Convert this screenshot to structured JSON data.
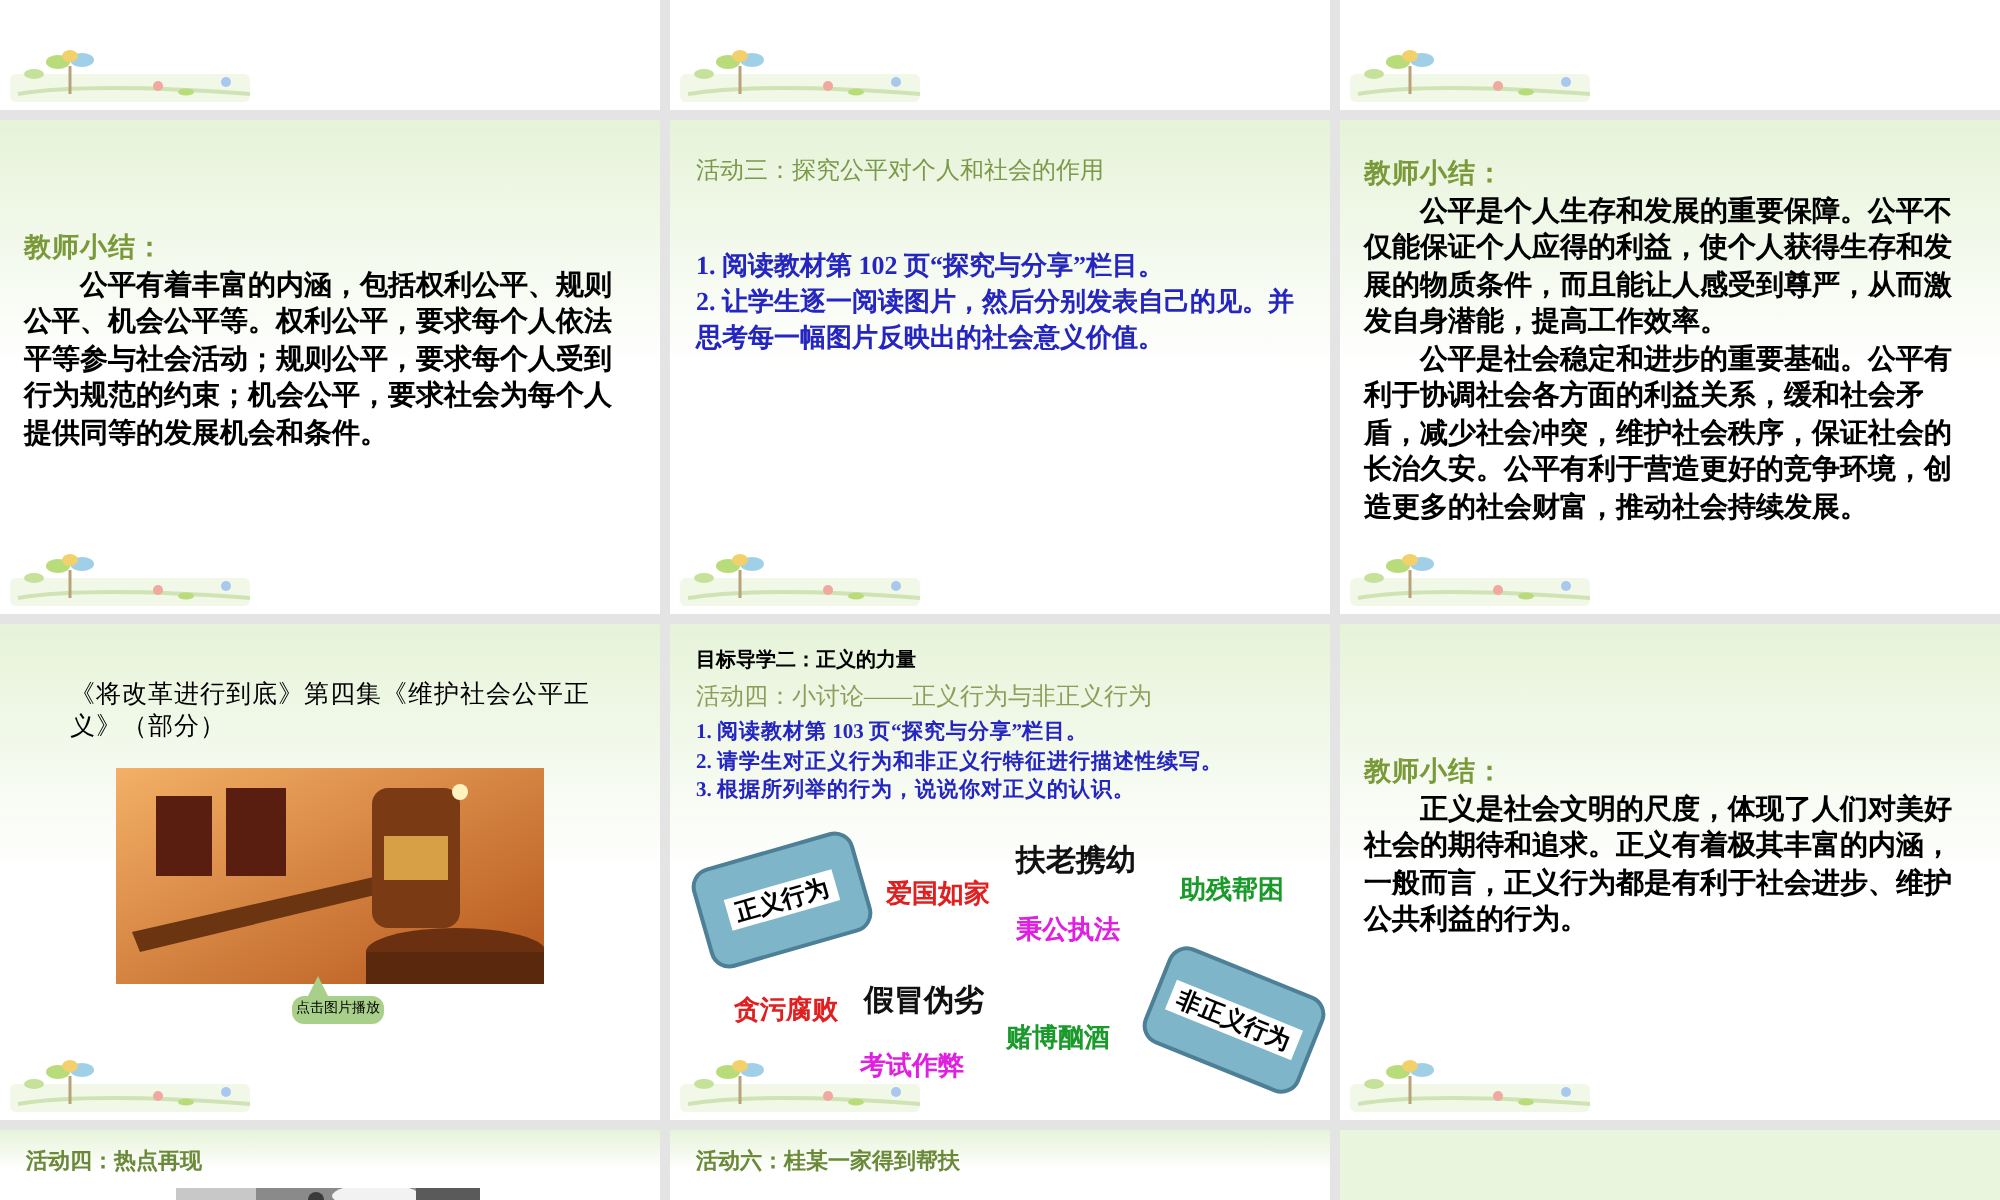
{
  "slides": [
    {
      "kind": "blank"
    },
    {
      "kind": "blank"
    },
    {
      "kind": "blank"
    },
    {
      "kind": "summary",
      "heading": "教师小结：",
      "paragraphs": [
        "公平有着丰富的内涵，包括权利公平、规则公平、机会公平等。权利公平，要求每个人依法平等参与社会活动；规则公平，要求每个人受到行为规范的约束；机会公平，要求社会为每个人提供同等的发展机会和条件。"
      ]
    },
    {
      "kind": "activity",
      "title": "活动三：探究公平对个人和社会的作用",
      "items": [
        "1. 阅读教材第 102 页“探究与分享”栏目。",
        "2. 让学生逐一阅读图片，然后分别发表自己的见。并思考每一幅图片反映出的社会意义价值。"
      ]
    },
    {
      "kind": "summary",
      "heading": "教师小结：",
      "paragraphs": [
        "公平是个人生存和发展的重要保障。公平不仅能保证个人应得的利益，使个人获得生存和发展的物质条件，而且能让人感受到尊严，从而激发自身潜能，提高工作效率。",
        "公平是社会稳定和进步的重要基础。公平有利于协调社会各方面的利益关系，缓和社会矛盾，减少社会冲突，维护社会秩序，保证社会的长治久安。公平有利于营造更好的竞争环境，创造更多的社会财富，推动社会持续发展。"
      ]
    },
    {
      "kind": "video",
      "caption": "《将改革进行到底》第四集《维护社会公平正义》（部分）",
      "callout": "点击图片播放"
    },
    {
      "kind": "discussion",
      "goal": "目标导学二：正义的力量",
      "title": "活动四：小讨论——正义行为与非正义行为",
      "items": [
        "1. 阅读教材第 103 页“探究与分享”栏目。",
        "2. 请学生对正义行为和非正义行特征进行描述性续写。",
        "3. 根据所列举的行为，说说你对正义的认识。"
      ],
      "signs": [
        "正义行为",
        "非正义行为"
      ],
      "words": [
        {
          "text": "爱国如家",
          "color": "#e02020"
        },
        {
          "text": "扶老携幼",
          "color": "#111111"
        },
        {
          "text": "助残帮困",
          "color": "#1a9a2a"
        },
        {
          "text": "秉公执法",
          "color": "#e020e0"
        },
        {
          "text": "贪污腐败",
          "color": "#e02020"
        },
        {
          "text": "假冒伪劣",
          "color": "#111111"
        },
        {
          "text": "赌博酗酒",
          "color": "#1a9a2a"
        },
        {
          "text": "考试作弊",
          "color": "#e020e0"
        }
      ]
    },
    {
      "kind": "summary",
      "heading": "教师小结：",
      "paragraphs": [
        "正义是社会文明的尺度，体现了人们对美好社会的期待和追求。正义有着极其丰富的内涵，一般而言，正义行为都是有利于社会进步、维护公共利益的行为。"
      ]
    },
    {
      "kind": "partial_picture",
      "title": "活动四：热点再现"
    },
    {
      "kind": "partial",
      "title": "活动六：桂某一家得到帮扶"
    },
    {
      "kind": "empty"
    }
  ]
}
